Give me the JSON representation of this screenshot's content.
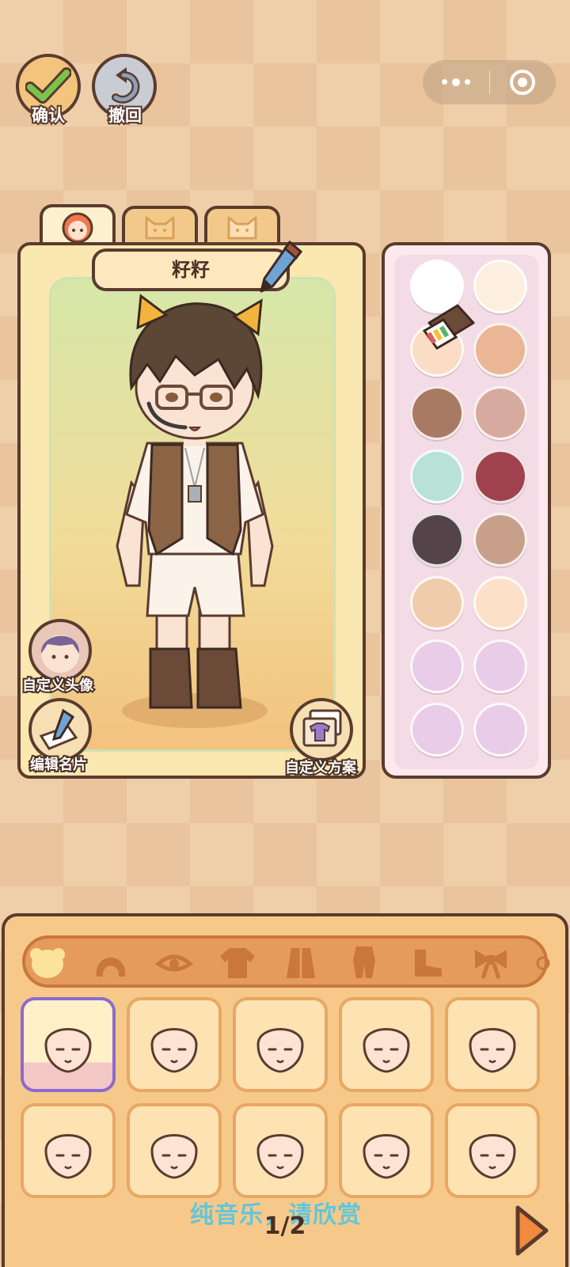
{
  "top_bar": {
    "confirm_label": "确认",
    "undo_label": "撤回"
  },
  "character": {
    "name": "籽籽"
  },
  "tabs": [
    {
      "icon": "girl-face-icon",
      "active": true
    },
    {
      "icon": "cat-face-icon",
      "active": false
    },
    {
      "icon": "cat-face-icon",
      "active": false
    }
  ],
  "side_buttons": {
    "custom_avatar": "自定义头像",
    "edit_card": "编辑名片",
    "custom_scheme": "自定义方案"
  },
  "palette": [
    "#ffffff",
    "#fdefdf",
    "#fbdcc4",
    "#ebb696",
    "#a97a63",
    "#d7aaa0",
    "#b9e2d6",
    "#a0424d",
    "#54444a",
    "#c8a08a",
    "#f0ccac",
    "#fde0c8",
    "#e9cde8",
    "#e9cde8",
    "#e9cde8",
    "#e9cde8"
  ],
  "categories": [
    "face-base-icon",
    "hair-icon",
    "eye-icon",
    "shirt-icon",
    "coat-icon",
    "outfit-icon",
    "shoe-icon",
    "bow-icon",
    "earring-icon"
  ],
  "items_count": 10,
  "footer": {
    "marquee": "纯音乐，请欣赏",
    "page": "1/2"
  }
}
